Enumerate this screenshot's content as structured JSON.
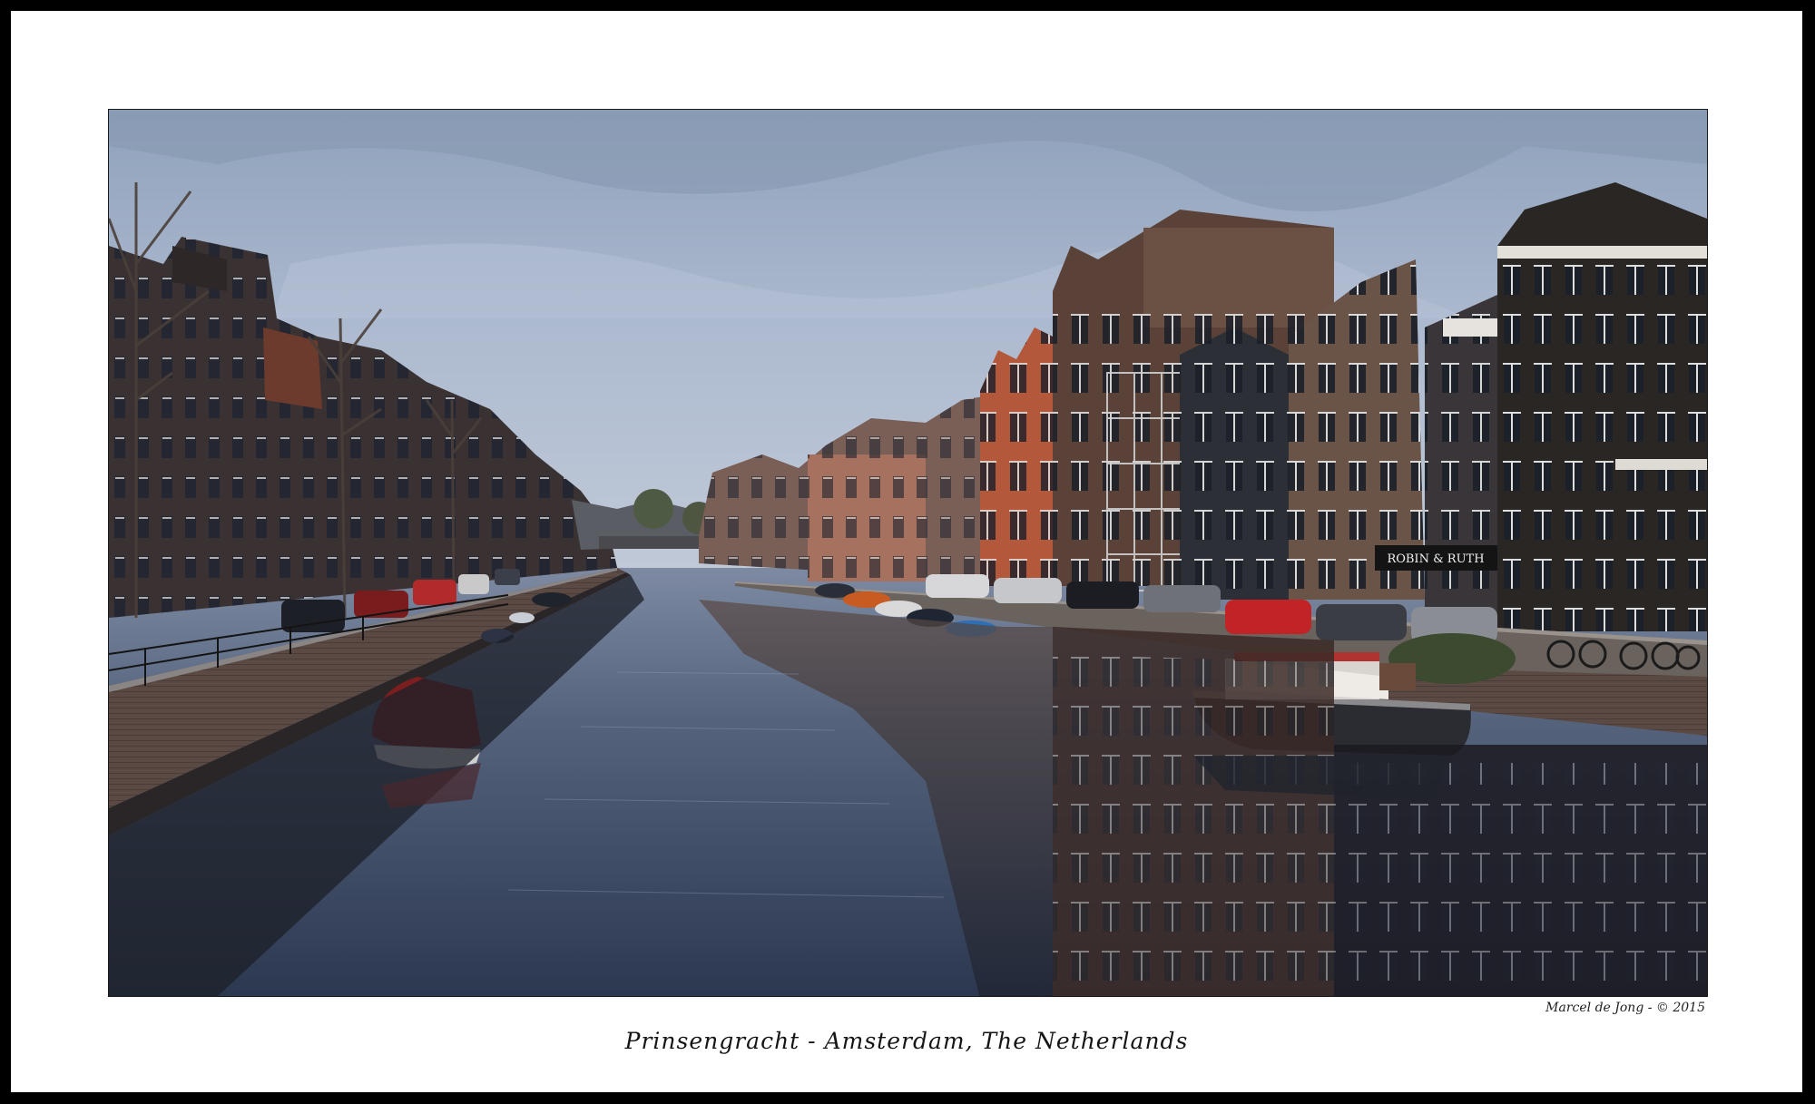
{
  "photo": {
    "caption": "Prinsengracht - Amsterdam, The Netherlands",
    "credit": "Marcel de Jong  - © 2015",
    "shop_sign": "ROBIN & RUTH",
    "colors": {
      "outer_border": "#000000",
      "mat": "#ffffff",
      "sky": "#9fb0c8",
      "water": "#3c4a60"
    }
  }
}
